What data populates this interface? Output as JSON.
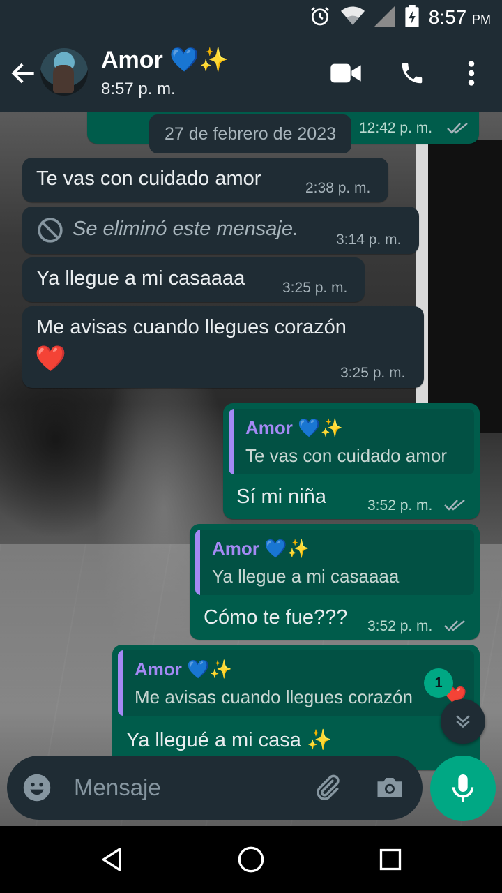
{
  "status_bar": {
    "time": "8:57",
    "ampm": "PM",
    "icons": [
      "alarm-icon",
      "wifi-icon",
      "signal-icon",
      "battery-charging-icon"
    ]
  },
  "header": {
    "contact_name": "Amor 💙✨",
    "last_seen": "8:57 p. m.",
    "icons": [
      "back-arrow-icon",
      "video-call-icon",
      "phone-icon",
      "more-vert-icon"
    ]
  },
  "chat": {
    "date_chip": "27 de febrero de 2023",
    "partial_top_time": "12:42 p. m.",
    "messages": [
      {
        "direction": "in",
        "text": "Te vas con cuidado amor",
        "time": "2:38 p. m."
      },
      {
        "direction": "in",
        "deleted": true,
        "text": "Se eliminó este mensaje.",
        "time": "3:14 p. m."
      },
      {
        "direction": "in",
        "text": "Ya llegue a mi casaaaa",
        "time": "3:25 p. m."
      },
      {
        "direction": "in",
        "text": "Me avisas cuando llegues corazón",
        "emoji": "❤️",
        "time": "3:25 p. m."
      },
      {
        "direction": "out",
        "quote_name": "Amor 💙✨",
        "quote_text": "Te vas con cuidado amor",
        "text": "Sí mi niña",
        "time": "3:52 p. m."
      },
      {
        "direction": "out",
        "quote_name": "Amor 💙✨",
        "quote_text": "Ya llegue a mi casaaaa",
        "text": "Cómo te fue???",
        "time": "3:52 p. m."
      },
      {
        "direction": "out",
        "quote_name": "Amor 💙✨",
        "quote_text": "Me avisas cuando llegues corazón",
        "quote_emoji": "❤️",
        "text": "Ya llegué a mi casa ✨"
      }
    ],
    "unread_count": "1"
  },
  "composer": {
    "placeholder": "Mensaje",
    "icons": [
      "emoji-icon",
      "attach-icon",
      "camera-icon",
      "mic-icon"
    ]
  },
  "colors": {
    "header_bg": "#1f2c34",
    "incoming_bubble": "#1f2c34",
    "outgoing_bubble": "#005c4b",
    "accent_green": "#00a884",
    "quote_name": "#a489f4"
  }
}
